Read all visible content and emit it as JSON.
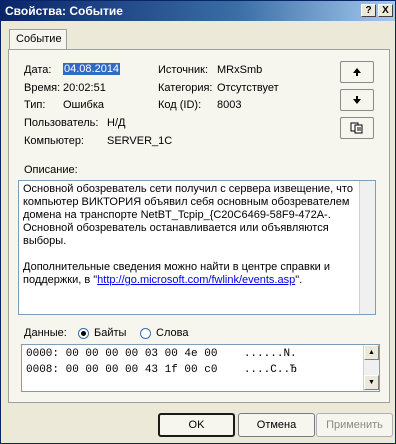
{
  "window": {
    "title": "Свойства: Событие",
    "help_label": "?",
    "close_label": "X"
  },
  "tab": {
    "label": "Событие"
  },
  "fields": {
    "date_label": "Дата:",
    "date_value": "04.08.2014",
    "time_label": "Время:",
    "time_value": "20:02:51",
    "type_label": "Тип:",
    "type_value": "Ошибка",
    "user_label": "Пользователь:",
    "user_value": "Н/Д",
    "computer_label": "Компьютер:",
    "computer_value": "SERVER_1C",
    "source_label": "Источник:",
    "source_value": "MRxSmb",
    "category_label": "Категория:",
    "category_value": "Отсутствует",
    "code_label": "Код (ID):",
    "code_value": "8003"
  },
  "nav": {
    "up_icon": "arrow-up-icon",
    "down_icon": "arrow-down-icon",
    "copy_icon": "copy-icon"
  },
  "description": {
    "label": "Описание:",
    "p1": "Основной обозреватель сети получил с сервера извещение, что компьютер ВИКТОРИЯ объявил себя основным обозревателем домена на транспорте NetBT_Tcpip_{C20C6469-58F9-472A-. Основной обозреватель останавливается или объявляются выборы.",
    "p2_pre": "Дополнительные сведения можно найти в центре справки и поддержки, в \"",
    "link": "http://go.microsoft.com/fwlink/events.asp",
    "p2_post": "\"."
  },
  "data_section": {
    "label": "Данные:",
    "bytes_label": "Байты",
    "words_label": "Слова",
    "lines": [
      "0000: 00 00 00 00 03 00 4e 00    ......N.",
      "0008: 00 00 00 00 43 1f 00 c0    ....C..Ђ"
    ]
  },
  "buttons": {
    "ok": "OK",
    "cancel": "Отмена",
    "apply": "Применить"
  }
}
